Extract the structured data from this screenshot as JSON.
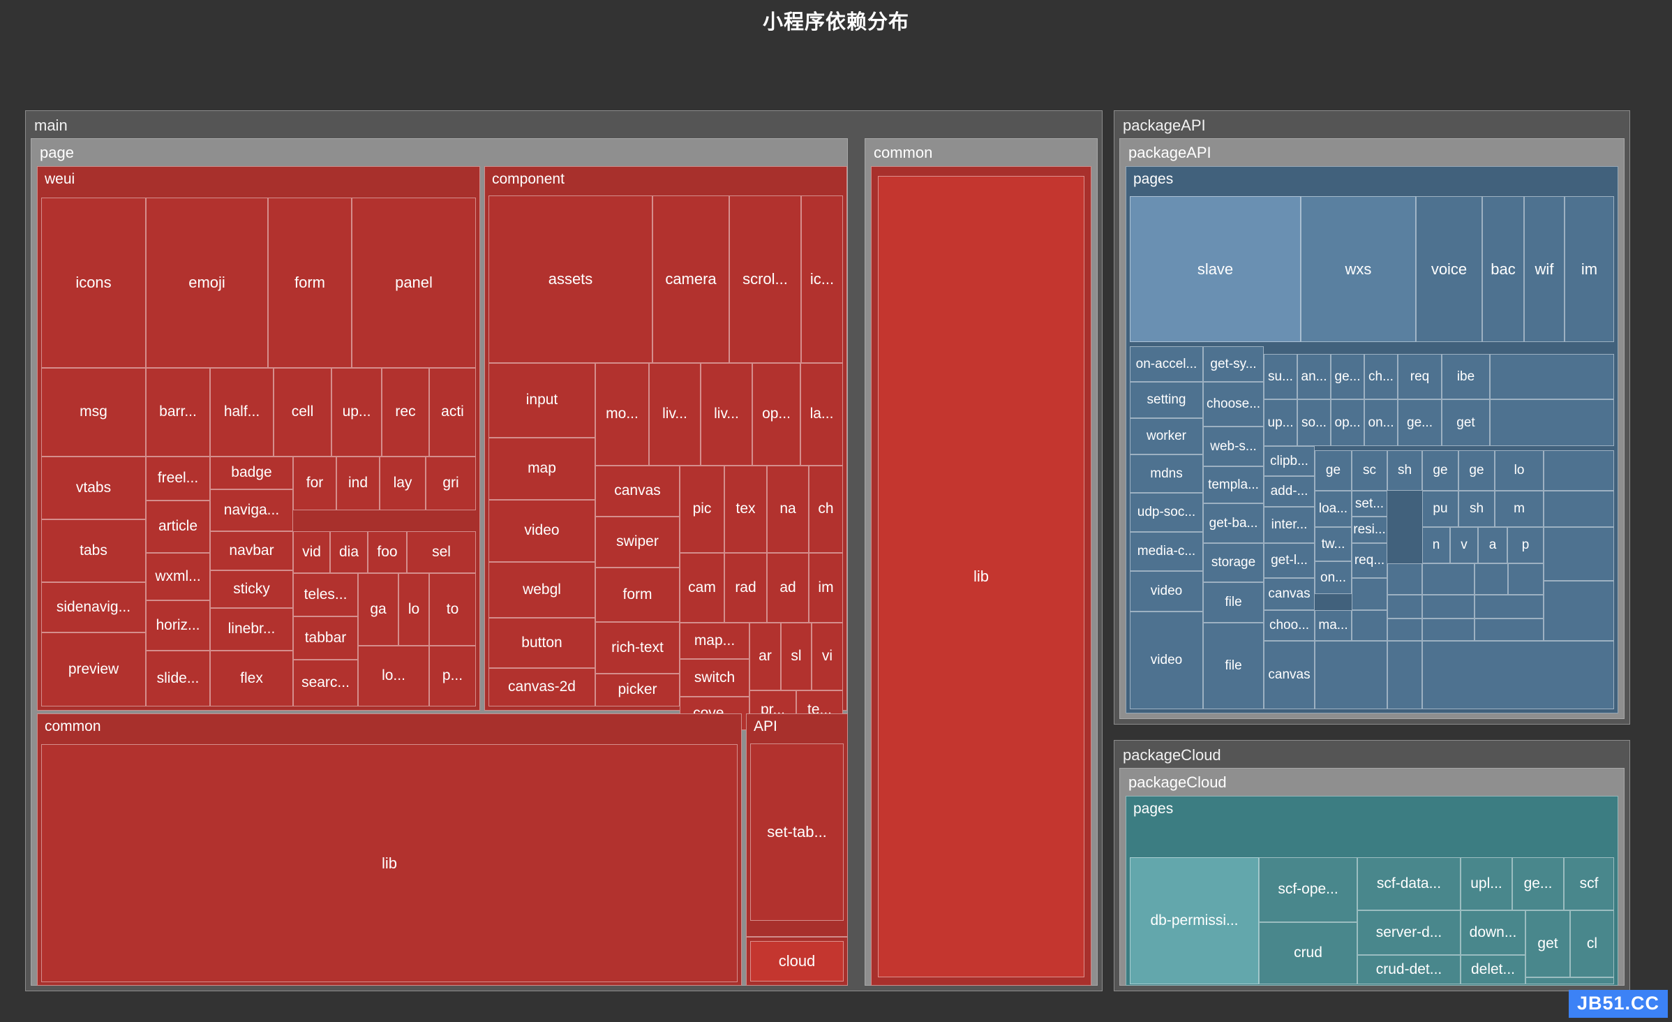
{
  "title": "小程序依赖分布",
  "watermark": "JB51.CC",
  "colors": {
    "background": "#333333",
    "frame_level0": "#555555",
    "frame_level1": "#8f8f8f",
    "red_dark": "#A8302C",
    "red": "#B2322E",
    "red_bright": "#C4362F",
    "blue_header": "#41617C",
    "blue_light": "#6A90B2",
    "blue": "#4E7290",
    "teal_header": "#3C7D82",
    "teal_light": "#63A7AC",
    "teal": "#49878C",
    "watermark_bg": "#3C82F6"
  },
  "chart_data": {
    "type": "treemap",
    "title": "小程序依赖分布",
    "roots": [
      {
        "name": "main",
        "children": [
          {
            "name": "page",
            "children": [
              {
                "name": "weui",
                "leaves": [
                  "icons",
                  "emoji",
                  "form",
                  "panel",
                  "msg",
                  "barr...",
                  "half...",
                  "cell",
                  "up...",
                  "rec",
                  "acti",
                  "vtabs",
                  "freel...",
                  "badge",
                  "for",
                  "ind",
                  "lay",
                  "gri",
                  "tabs",
                  "article",
                  "naviga...",
                  "navbar",
                  "wxml...",
                  "vid",
                  "dia",
                  "foo",
                  "sel",
                  "sidenavig...",
                  "sticky",
                  "teles...",
                  "horiz...",
                  "linebr...",
                  "ga",
                  "lo",
                  "to",
                  "tabbar",
                  "preview",
                  "slide...",
                  "flex",
                  "searc...",
                  "lo...",
                  "p..."
                ]
              },
              {
                "name": "component",
                "leaves": [
                  "assets",
                  "camera",
                  "scrol...",
                  "ic...",
                  "input",
                  "mo...",
                  "liv...",
                  "liv...",
                  "op...",
                  "la...",
                  "map",
                  "canvas",
                  "pic",
                  "tex",
                  "na",
                  "ch",
                  "video",
                  "swiper",
                  "cam",
                  "rad",
                  "ad",
                  "im",
                  "webgl",
                  "form",
                  "button",
                  "rich-text",
                  "map...",
                  "ar",
                  "sl",
                  "vi",
                  "switch",
                  "canvas-2d",
                  "picker",
                  "cove...",
                  "pr...",
                  "te..."
                ]
              },
              {
                "name": "common",
                "leaves": [
                  "lib"
                ]
              },
              {
                "name": "API",
                "leaves": [
                  "set-tab...",
                  "cloud"
                ]
              }
            ]
          },
          {
            "name": "common",
            "leaves": [
              "lib"
            ]
          }
        ]
      },
      {
        "name": "packageAPI",
        "children": [
          {
            "name": "packageAPI",
            "children": [
              {
                "name": "pages",
                "leaves": [
                  "slave",
                  "wxs",
                  "voice",
                  "bac",
                  "wif",
                  "im",
                  "on-accel...",
                  "get-sy...",
                  "su...",
                  "an...",
                  "ge...",
                  "ch...",
                  "req",
                  "ibe",
                  "setting",
                  "choose...",
                  "up...",
                  "so...",
                  "op...",
                  "on...",
                  "ge...",
                  "get",
                  "worker",
                  "web-s...",
                  "clipb...",
                  "ge",
                  "sc",
                  "sh",
                  "ge",
                  "ge",
                  "lo",
                  "mdns",
                  "templa...",
                  "add-...",
                  "loa...",
                  "set...",
                  "pu",
                  "sh",
                  "m",
                  "udp-soc...",
                  "get-ba...",
                  "inter...",
                  "tw...",
                  "resi...",
                  "n",
                  "v",
                  "a",
                  "p",
                  "media-c...",
                  "storage",
                  "get-l...",
                  "on...",
                  "req...",
                  "video",
                  "file",
                  "canvas",
                  "choo...",
                  "ma..."
                ]
              }
            ]
          }
        ]
      },
      {
        "name": "packageCloud",
        "children": [
          {
            "name": "packageCloud",
            "children": [
              {
                "name": "pages",
                "leaves": [
                  "db-permissi...",
                  "scf-ope...",
                  "scf-data...",
                  "upl...",
                  "ge...",
                  "scf",
                  "crud",
                  "server-d...",
                  "down...",
                  "get",
                  "cl",
                  "crud-det...",
                  "delet..."
                ]
              }
            ]
          }
        ]
      }
    ]
  },
  "labels": {
    "main": "main",
    "page": "page",
    "weui": "weui",
    "component": "component",
    "common": "common",
    "api": "API",
    "lib": "lib",
    "packageAPI": "packageAPI",
    "packageAPI_inner": "packageAPI",
    "pagesAPI": "pages",
    "packageCloud": "packageCloud",
    "packageCloud_inner": "packageCloud",
    "pagesCloud": "pages"
  },
  "weui": {
    "t": [
      "icons",
      "emoji",
      "form",
      "panel",
      "msg",
      "barr...",
      "half...",
      "cell",
      "up...",
      "rec",
      "acti",
      "vtabs",
      "freel...",
      "badge",
      "for",
      "ind",
      "lay",
      "gri",
      "tabs",
      "article",
      "naviga...",
      "navbar",
      "wxml...",
      "vid",
      "dia",
      "foo",
      "sel",
      "sidenavig...",
      "sticky",
      "teles...",
      "horiz...",
      "linebr...",
      "ga",
      "lo",
      "to",
      "tabbar",
      "preview",
      "slide...",
      "flex",
      "searc...",
      "lo...",
      "p..."
    ]
  },
  "component": {
    "t": [
      "assets",
      "camera",
      "scrol...",
      "ic...",
      "input",
      "mo...",
      "liv...",
      "liv...",
      "op...",
      "la...",
      "map",
      "canvas",
      "pic",
      "tex",
      "na",
      "ch",
      "video",
      "swiper",
      "cam",
      "rad",
      "ad",
      "im",
      "webgl",
      "form",
      "button",
      "rich-text",
      "map...",
      "ar",
      "sl",
      "vi",
      "switch",
      "canvas-2d",
      "picker",
      "cove...",
      "pr...",
      "te..."
    ]
  },
  "api": {
    "t": [
      "set-tab...",
      "cloud"
    ]
  },
  "pkgapi": {
    "t": [
      "slave",
      "wxs",
      "voice",
      "bac",
      "wif",
      "im",
      "on-accel...",
      "get-sy...",
      "su...",
      "an...",
      "ge...",
      "ch...",
      "req",
      "ibe",
      "setting",
      "choose...",
      "up...",
      "so...",
      "op...",
      "on...",
      "ge...",
      "get",
      "worker",
      "web-s...",
      "clipb...",
      "ge",
      "sc",
      "sh",
      "ge",
      "ge",
      "lo",
      "mdns",
      "templa...",
      "add-...",
      "loa...",
      "set...",
      "pu",
      "sh",
      "m",
      "udp-soc...",
      "get-ba...",
      "inter...",
      "tw...",
      "resi...",
      "n",
      "v",
      "a",
      "p",
      "media-c...",
      "storage",
      "get-l...",
      "on...",
      "req...",
      "video",
      "file",
      "canvas",
      "choo...",
      "ma..."
    ]
  },
  "pkgcloud": {
    "t": [
      "db-permissi...",
      "scf-ope...",
      "scf-data...",
      "upl...",
      "ge...",
      "scf",
      "crud",
      "server-d...",
      "down...",
      "get",
      "cl",
      "crud-det...",
      "delet..."
    ]
  }
}
